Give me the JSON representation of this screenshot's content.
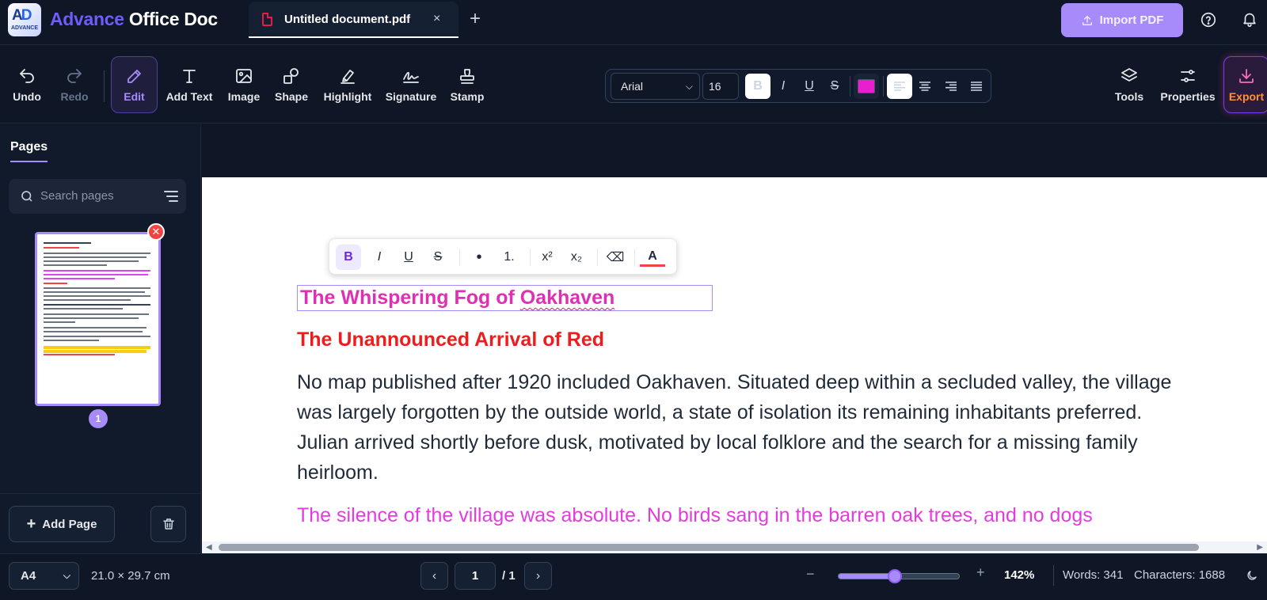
{
  "app": {
    "brand_part1": "Advance",
    "brand_part2": " Office Doc",
    "logo_text": "ADVANCE"
  },
  "tab": {
    "title": "Untitled document.pdf",
    "close": "×",
    "new_tab": "+"
  },
  "header": {
    "import_label": "Import PDF"
  },
  "toolbar": {
    "undo": "Undo",
    "redo": "Redo",
    "edit": "Edit",
    "add_text": "Add Text",
    "image": "Image",
    "shape": "Shape",
    "highlight": "Highlight",
    "signature": "Signature",
    "stamp": "Stamp",
    "tools": "Tools",
    "properties": "Properties",
    "export": "Export"
  },
  "format": {
    "font": "Arial",
    "size": "16",
    "bold": "B",
    "italic": "I",
    "underline": "U",
    "strike": "S",
    "color": "#e91ed1"
  },
  "sidebar": {
    "title": "Pages",
    "search_placeholder": "Search pages",
    "page_number": "1",
    "add_page": "Add Page"
  },
  "mini_toolbar": {
    "bold": "B",
    "italic": "I",
    "underline": "U",
    "strike": "S",
    "bullet": "•",
    "numbered": "1.",
    "superscript": "x²",
    "subscript": "x₂",
    "clear": "⌫",
    "text_color": "A"
  },
  "document": {
    "title_part1": "The Whispering Fog of ",
    "title_part2": "Oakhaven",
    "subtitle": "The Unannounced Arrival of Red",
    "paragraph1": "No map published after 1920 included Oakhaven. Situated deep within a secluded valley, the village was largely forgotten by the outside world, a state of isolation its remaining inhabitants preferred. Julian arrived shortly before dusk, motivated by local folklore and the search for a missing family heirloom.",
    "paragraph2": "The silence of the village was absolute. No birds sang in the barren oak trees, and no dogs"
  },
  "status": {
    "paper_size": "A4",
    "dimensions": "21.0 × 29.7 cm",
    "current_page": "1",
    "total_pages": "/ 1",
    "zoom": "142%",
    "zoom_fraction": 0.47,
    "words": "Words: 341",
    "characters": "Characters: 1688"
  }
}
